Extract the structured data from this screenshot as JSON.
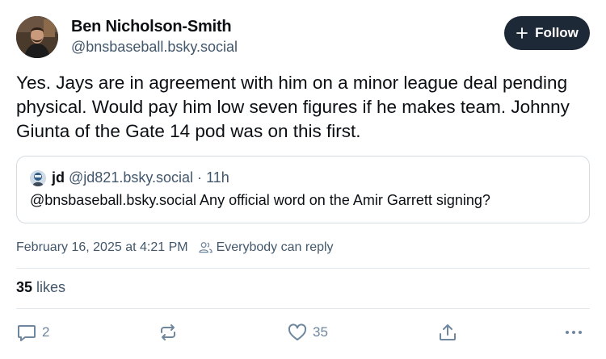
{
  "author": {
    "name": "Ben Nicholson-Smith",
    "handle": "@bnsbaseball.bsky.social"
  },
  "follow_button": {
    "label": "Follow",
    "icon": "plus-icon",
    "color": "#1e2937"
  },
  "post": {
    "text": "Yes. Jays are in agreement with him on a minor league deal pending physical. Would pay him low seven figures if he makes team. Johnny Giunta of the Gate 14 pod was on this first."
  },
  "quote": {
    "author": "jd",
    "handle": "@jd821.bsky.social",
    "separator": "·",
    "time": "11h",
    "text": "@bnsbaseball.bsky.social Any official word on the Amir Garrett signing?"
  },
  "meta": {
    "timestamp": "February 16, 2025 at 4:21 PM",
    "reply_setting": "Everybody can reply",
    "reply_setting_icon": "people-icon"
  },
  "likes": {
    "count": "35",
    "label": "likes"
  },
  "actions": {
    "reply_count": "2",
    "repost_count": "",
    "like_count": "35"
  },
  "colors": {
    "text_primary": "#0b0f14",
    "text_secondary": "#42576c",
    "icon": "#6f869f",
    "border": "#d4dbe2"
  }
}
